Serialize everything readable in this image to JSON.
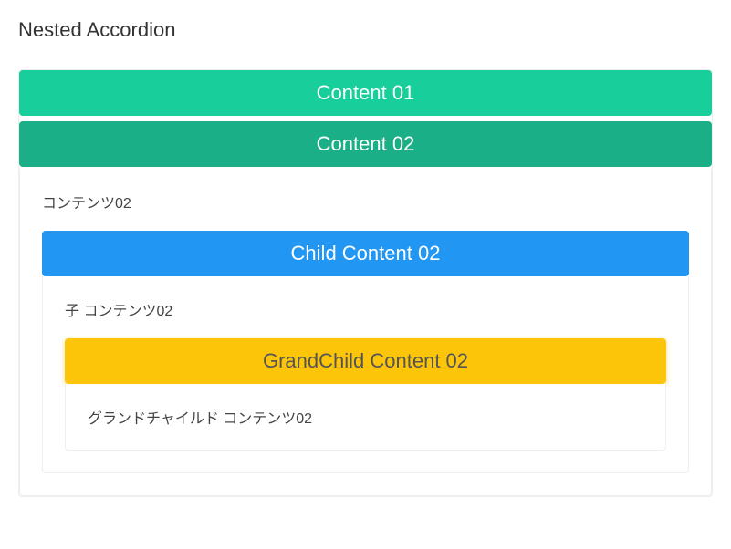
{
  "title": "Nested Accordion",
  "accordion": {
    "item1": {
      "header": "Content 01"
    },
    "item2": {
      "header": "Content 02",
      "body_text": "コンテンツ02",
      "child": {
        "header": "Child Content 02",
        "body_text": "子 コンテンツ02",
        "grandchild": {
          "header": "GrandChild Content 02",
          "body_text": "グランドチャイルド コンテンツ02"
        }
      }
    }
  }
}
